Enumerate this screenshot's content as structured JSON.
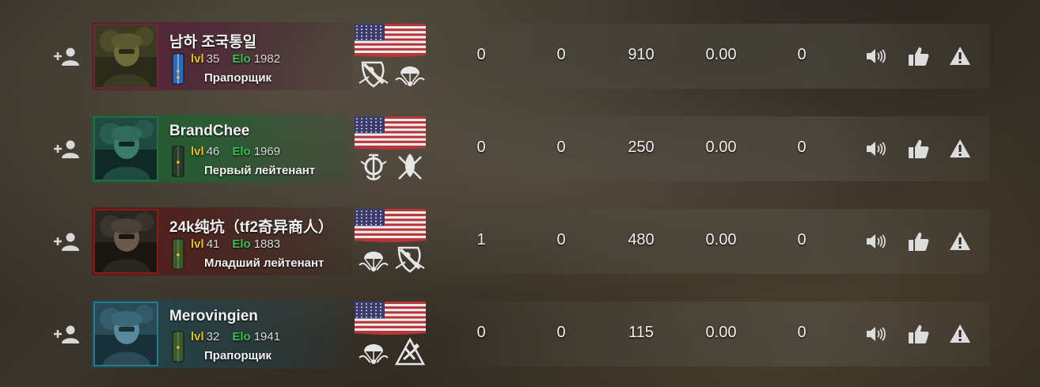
{
  "players": [
    {
      "name": "남하 조국통일",
      "lvl_label": "lvl",
      "lvl": "35",
      "elo_label": "Elo",
      "elo": "1982",
      "rank": "Прапорщик",
      "stats": [
        "0",
        "0",
        "910",
        "0.00",
        "0"
      ],
      "flag": "usa-flag-icon",
      "units": [
        "cavalry-unit-icon",
        "airborne-unit-icon"
      ],
      "card_color": "#5a1e3a"
    },
    {
      "name": "BrandChee",
      "lvl_label": "lvl",
      "lvl": "46",
      "elo_label": "Elo",
      "elo": "1969",
      "rank": "Первый лейтенант",
      "stats": [
        "0",
        "0",
        "250",
        "0.00",
        "0"
      ],
      "flag": "usa-flag-icon",
      "units": [
        "marines-unit-icon",
        "special-forces-unit-icon"
      ],
      "card_color": "#1e5a30"
    },
    {
      "name": "24k纯坑（tf2奇异商人）",
      "lvl_label": "lvl",
      "lvl": "41",
      "elo_label": "Elo",
      "elo": "1883",
      "rank": "Младший лейтенант",
      "stats": [
        "1",
        "0",
        "480",
        "0.00",
        "0"
      ],
      "flag": "usa-flag-icon",
      "units": [
        "airborne-unit-icon",
        "cavalry-unit-icon"
      ],
      "card_color": "#5a1818"
    },
    {
      "name": "Merovingien",
      "lvl_label": "lvl",
      "lvl": "32",
      "elo_label": "Elo",
      "elo": "1941",
      "rank": "Прапорщик",
      "stats": [
        "0",
        "0",
        "115",
        "0.00",
        "0"
      ],
      "flag": "usa-flag-icon",
      "units": [
        "airborne-unit-icon",
        "engineer-unit-icon"
      ],
      "card_color": "#1e4a52"
    }
  ],
  "icons": {
    "add_friend": "add-friend-icon",
    "mute": "speaker-icon",
    "like": "thumbs-up-icon",
    "report": "warning-icon"
  }
}
